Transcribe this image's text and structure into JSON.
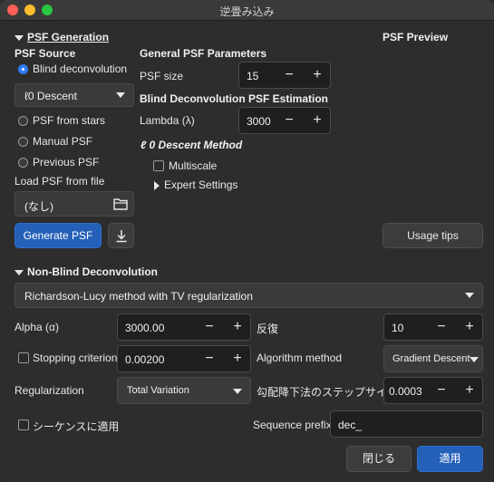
{
  "window": {
    "title": "逆畳み込み"
  },
  "psf": {
    "section": "PSF Generation",
    "source_header": "PSF Source",
    "blind": "Blind deconvolution",
    "method_dropdown": "ℓ0 Descent",
    "from_stars": "PSF from stars",
    "manual": "Manual PSF",
    "previous": "Previous PSF",
    "load_label": "Load PSF from file",
    "file_value": "(なし)",
    "generate_button": "Generate PSF",
    "general_header": "General PSF Parameters",
    "size_label": "PSF size",
    "size_value": "15",
    "blind_header": "Blind Deconvolution PSF Estimation",
    "lambda_label": "Lambda (λ)",
    "lambda_value": "3000",
    "l0_header": "ℓ 0 Descent Method",
    "multiscale": "Multiscale",
    "expert": "Expert Settings",
    "preview_header": "PSF Preview",
    "usage_button": "Usage tips"
  },
  "nonblind": {
    "section": "Non-Blind Deconvolution",
    "method": "Richardson-Lucy method with TV regularization",
    "alpha_label": "Alpha (α)",
    "alpha_value": "3000.00",
    "iter_label": "反復",
    "iter_value": "10",
    "stop_label": "Stopping criterion",
    "stop_value": "0.00200",
    "algo_label": "Algorithm method",
    "algo_value": "Gradient Descent",
    "reg_label": "Regularization",
    "reg_value": "Total Variation",
    "step_label": "勾配降下法のステップサイズ",
    "step_value": "0.0003",
    "sequence_label": "シーケンスに適用",
    "prefix_label": "Sequence prefix:",
    "prefix_value": "dec_"
  },
  "footer": {
    "close": "閉じる",
    "apply": "適用"
  },
  "glyphs": {
    "minus": "−",
    "plus": "+"
  },
  "colors": {
    "accent": "#2f7bf5",
    "primary_button": "#2460b8",
    "traffic_red": "#ff5f57",
    "traffic_yellow": "#febc2e",
    "traffic_green": "#28c840"
  },
  "icons": [
    "folder-icon",
    "download-icon",
    "chevron-down-icon"
  ]
}
